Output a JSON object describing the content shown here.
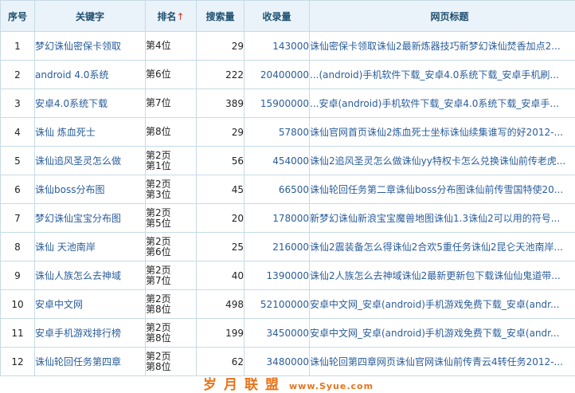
{
  "headers": {
    "no": "序号",
    "keyword": "关键字",
    "rank": "排名",
    "rank_arrow": "↑",
    "volume": "搜索量",
    "indexed": "收录量",
    "title": "网页标题"
  },
  "rows": [
    {
      "no": "1",
      "keyword": "梦幻诛仙密保卡领取",
      "rank1": "第4位",
      "rank2": "",
      "volume": "29",
      "indexed": "143000",
      "title": "诛仙密保卡领取诛仙2最新炼器技巧新梦幻诛仙焚香加点2..."
    },
    {
      "no": "2",
      "keyword": "android 4.0系统",
      "rank1": "第6位",
      "rank2": "",
      "volume": "222",
      "indexed": "20400000",
      "title": "...(android)手机软件下载_安卓4.0系统下载_安卓手机刷..."
    },
    {
      "no": "3",
      "keyword": "安卓4.0系统下载",
      "rank1": "第7位",
      "rank2": "",
      "volume": "389",
      "indexed": "15900000",
      "title": "...安卓(android)手机软件下载_安卓4.0系统下载_安卓手..."
    },
    {
      "no": "4",
      "keyword": "诛仙 炼血死士",
      "rank1": "第8位",
      "rank2": "",
      "volume": "29",
      "indexed": "57800",
      "title": "诛仙官网首页诛仙2炼血死士坐标诛仙续集谁写的好2012-..."
    },
    {
      "no": "5",
      "keyword": "诛仙追风圣灵怎么做",
      "rank1": "第2页",
      "rank2": "第1位",
      "volume": "56",
      "indexed": "454000",
      "title": "诛仙2追风圣灵怎么做诛仙yy特权卡怎么兑换诛仙前传老虎..."
    },
    {
      "no": "6",
      "keyword": "诛仙boss分布图",
      "rank1": "第2页",
      "rank2": "第3位",
      "volume": "45",
      "indexed": "66500",
      "title": "诛仙轮回任务第二章诛仙boss分布图诛仙前传雪国特使20..."
    },
    {
      "no": "7",
      "keyword": "梦幻诛仙宝宝分布图",
      "rank1": "第2页",
      "rank2": "第5位",
      "volume": "20",
      "indexed": "178000",
      "title": "新梦幻诛仙新浪宝宝魔兽地图诛仙1.3诛仙2可以用的符号..."
    },
    {
      "no": "8",
      "keyword": "诛仙 天池南岸",
      "rank1": "第2页",
      "rank2": "第6位",
      "volume": "25",
      "indexed": "216000",
      "title": "诛仙2震装备怎么得诛仙2合欢5重任务诛仙2昆仑天池南岸..."
    },
    {
      "no": "9",
      "keyword": "诛仙人族怎么去神域",
      "rank1": "第2页",
      "rank2": "第7位",
      "volume": "40",
      "indexed": "1390000",
      "title": "诛仙2人族怎么去神域诛仙2最新更新包下载诛仙仙鬼道带..."
    },
    {
      "no": "10",
      "keyword": "安卓中文网",
      "rank1": "第2页",
      "rank2": "第8位",
      "volume": "498",
      "indexed": "52100000",
      "title": "安卓中文网_安卓(android)手机游戏免费下载_安卓(andr..."
    },
    {
      "no": "11",
      "keyword": "安卓手机游戏排行榜",
      "rank1": "第2页",
      "rank2": "第8位",
      "volume": "199",
      "indexed": "3450000",
      "title": "安卓中文网_安卓(android)手机游戏免费下载_安卓(andr..."
    },
    {
      "no": "12",
      "keyword": "诛仙轮回任务第四章",
      "rank1": "第2页",
      "rank2": "第8位",
      "volume": "62",
      "indexed": "3480000",
      "title": "诛仙轮回第四章网页诛仙官网诛仙前传青云4转任务2012-..."
    }
  ],
  "watermark": {
    "brand": "岁月联盟",
    "url": "www.Syue.com"
  }
}
